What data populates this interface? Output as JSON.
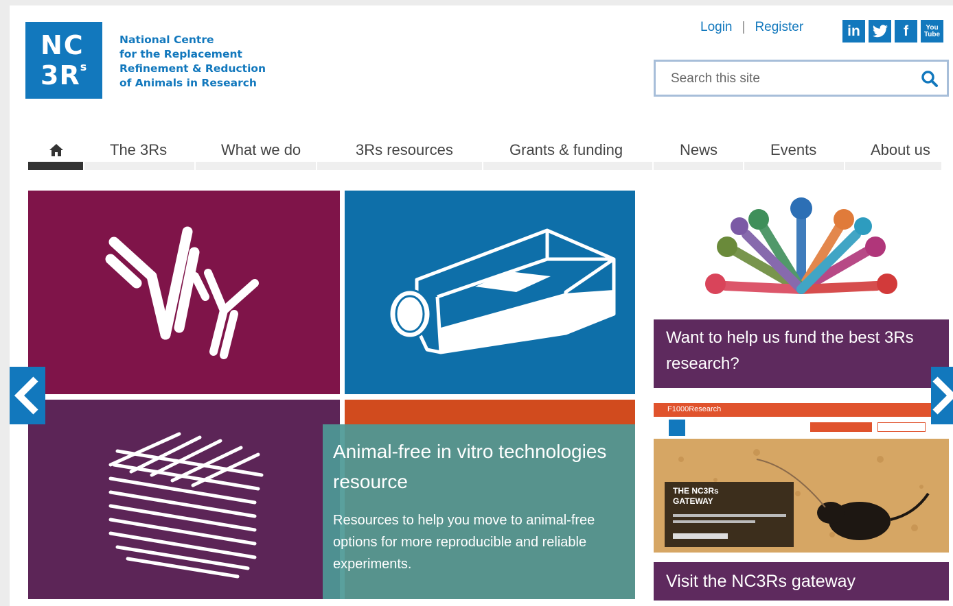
{
  "logo": {
    "nc": "NC",
    "three_r": "3R",
    "three_r_sup": "s",
    "lines": [
      "National Centre",
      "for the Replacement",
      "Refinement & Reduction",
      "of Animals in Research"
    ]
  },
  "header": {
    "login": "Login",
    "separator": "|",
    "register": "Register",
    "social": [
      {
        "label": "in",
        "icon": "linkedin-icon"
      },
      {
        "label": "t",
        "icon": "twitter-icon"
      },
      {
        "label": "f",
        "icon": "facebook-icon"
      },
      {
        "label": "You Tube",
        "icon": "youtube-icon"
      }
    ]
  },
  "search": {
    "placeholder": "Search this site"
  },
  "nav": {
    "home_icon": "home-icon",
    "items": [
      {
        "label": "The 3Rs"
      },
      {
        "label": "What we do"
      },
      {
        "label": "3Rs resources"
      },
      {
        "label": "Grants & funding"
      },
      {
        "label": "News"
      },
      {
        "label": "Events"
      },
      {
        "label": "About us"
      }
    ]
  },
  "feature": {
    "title": "Animal-free in vitro technologies resource",
    "description": "Resources to help you move to animal-free options for more reproducible and reliable experiments."
  },
  "side": {
    "fund_caption": "Want to help us fund the best 3Rs research?",
    "gateway_header": "F1000Research",
    "gateway_badge_line1": "THE NC3Rs",
    "gateway_badge_line2": "GATEWAY",
    "gateway_caption": "Visit the NC3Rs gateway"
  },
  "colors": {
    "brand_blue": "#1278bd",
    "tile_magenta": "#7f1449",
    "tile_blue": "#0e6fa9",
    "tile_purple": "#5c2557",
    "tile_orange": "#d14b1e",
    "overlay_teal": "#4e9996",
    "caption_purple": "#5e2a5e"
  }
}
